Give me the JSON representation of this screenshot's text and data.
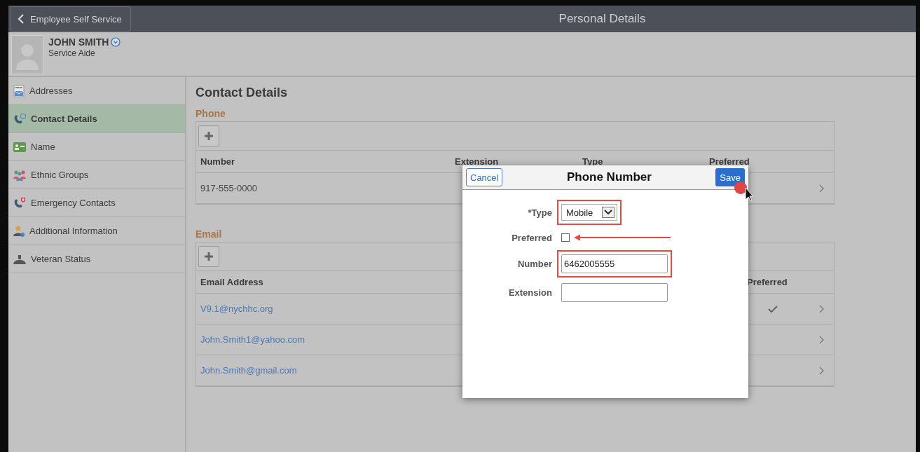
{
  "header": {
    "back_label": "Employee Self Service",
    "title": "Personal Details"
  },
  "profile": {
    "name": "JOHN SMITH",
    "job_title": "Service Aide"
  },
  "sidebar": {
    "items": [
      {
        "label": "Addresses",
        "kind": "addresses",
        "selected": false
      },
      {
        "label": "Contact Details",
        "kind": "contact",
        "selected": true
      },
      {
        "label": "Name",
        "kind": "name",
        "selected": false
      },
      {
        "label": "Ethnic Groups",
        "kind": "groups",
        "selected": false
      },
      {
        "label": "Emergency Contacts",
        "kind": "emergency",
        "selected": false
      },
      {
        "label": "Additional Information",
        "kind": "person",
        "selected": false
      },
      {
        "label": "Veteran Status",
        "kind": "veteran",
        "selected": false
      }
    ]
  },
  "content": {
    "title": "Contact Details",
    "phone": {
      "heading": "Phone",
      "columns": [
        "Number",
        "Extension",
        "Type",
        "Preferred"
      ],
      "rows": [
        {
          "number": "917-555-0000"
        }
      ]
    },
    "email": {
      "heading": "Email",
      "columns": [
        "Email Address",
        "Preferred"
      ],
      "rows": [
        {
          "address": "V9.1@nychhc.org",
          "preferred": true
        },
        {
          "address": "John.Smith1@yahoo.com",
          "preferred": false
        },
        {
          "address": "John.Smith@gmail.com",
          "preferred": false
        }
      ]
    }
  },
  "dialog": {
    "title": "Phone Number",
    "cancel": "Cancel",
    "save": "Save",
    "fields": [
      {
        "kind": "select",
        "label": "*Type",
        "value": "Mobile",
        "highlighted": true
      },
      {
        "kind": "checkbox",
        "label": "Preferred",
        "checked": false,
        "arrow": true
      },
      {
        "kind": "text",
        "label": "Number",
        "value": "6462005555",
        "highlighted": true
      },
      {
        "kind": "text",
        "label": "Extension",
        "highlighted": false
      }
    ]
  }
}
